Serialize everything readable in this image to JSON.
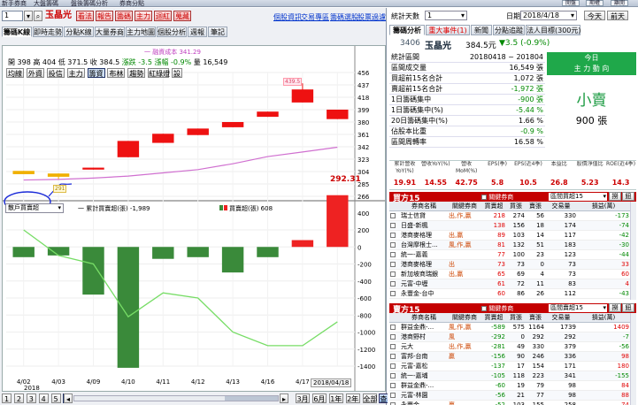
{
  "topbar": {
    "items": [
      "新手券商",
      "大盤籌碼",
      "盤後籌碼分析",
      "券商分點"
    ],
    "right_buttons": [
      "開盤",
      "期權",
      "離開"
    ]
  },
  "toolbar": {
    "code": "1",
    "stock": "玉晶光",
    "buttons": [
      "看法",
      "報告",
      "籌碼",
      "主力",
      "迴紅",
      "蒐藏"
    ],
    "links": [
      "個股資訊",
      "交易專區",
      "籌碼選股",
      "股票過濾"
    ]
  },
  "left_tabs": [
    "籌碼K線",
    "即時走勢",
    "分點K線",
    "大量券商",
    "主力地圖",
    "個股分析",
    "週報",
    "筆記"
  ],
  "chart": {
    "avg_cost_label": "一 融資成本 341.29",
    "ohlc": {
      "開": "398",
      "高": "404",
      "低": "371.5",
      "收": "384.5",
      "漲跌": "-3.5",
      "漲幅": "-0.9%",
      "量": "16,549"
    },
    "sub_tabs": [
      "均線",
      "外資",
      "投信",
      "主力",
      "籌資",
      "布林",
      "趨勢",
      "紅綠燈",
      "設"
    ],
    "active_sub_tab": "籌資",
    "price_label": "292.31",
    "high_label": "439.5",
    "low_label": "291",
    "lower_select": "散戶買賣超",
    "lower_legend_net": "一 累計買賣超(張) -1,989",
    "lower_legend_bar": "買賣超(張) 608",
    "date_box": "2018/04/18",
    "period_buttons": [
      "1",
      "2",
      "3",
      "4",
      "5",
      "6"
    ],
    "range_buttons": [
      "3月",
      "6月",
      "1年",
      "2年",
      "全部",
      "查看"
    ]
  },
  "chart_data": {
    "type": "candlestick",
    "x": [
      "4/02",
      "4/03",
      "4/09",
      "4/10",
      "4/11",
      "4/12",
      "4/13",
      "4/16",
      "4/17",
      "4/18"
    ],
    "year": "2018",
    "price_ticks": [
      456,
      437,
      418,
      399,
      380,
      361,
      342,
      323,
      304,
      285,
      266
    ],
    "open": [
      300,
      301,
      310,
      326,
      348,
      360,
      372,
      388,
      430,
      399
    ],
    "close": [
      305,
      296,
      307,
      351,
      362,
      370,
      380,
      396,
      410,
      384.5
    ],
    "high": [
      305,
      301,
      310,
      351,
      362,
      370,
      380,
      396,
      439.5,
      399
    ],
    "low": [
      300,
      291,
      307,
      326,
      348,
      360,
      372,
      388,
      410,
      384.5
    ],
    "avg_cost": [
      291,
      292,
      294,
      297,
      302,
      307,
      316,
      327,
      334,
      341.29
    ],
    "lower_ticks": [
      200,
      0,
      -200,
      -400,
      -600,
      -800,
      -1000,
      -1200,
      -1400
    ],
    "lower_top_label": "400",
    "net_values": [
      -120,
      -100,
      -560,
      -1420,
      -140,
      -120,
      -300,
      -120,
      80,
      608
    ],
    "cumulative": [
      200,
      -100,
      -200,
      -820,
      -540,
      -600,
      -1000,
      -1160,
      -1160,
      -880
    ]
  },
  "right": {
    "stat_type": "統計天數",
    "days": "1",
    "date_label": "日期:",
    "date": "2018/4/18",
    "today_btn": "今天",
    "prev_btn": "前天",
    "tabs": [
      "籌碼分析",
      "重大事件(1)",
      "新聞",
      "分點追蹤",
      "法人目標(300元)"
    ],
    "code": "3406",
    "name": "玉晶光",
    "price": "384.5元",
    "change": "▼3.5 (-0.9%)",
    "stats": [
      {
        "k": "統計區間",
        "v": "20180418 ~ 201804"
      },
      {
        "k": "區間成交量",
        "v": "16,549 張"
      },
      {
        "k": "買超前15名合計",
        "v": "1,072 張"
      },
      {
        "k": "賣超前15名合計",
        "v": "-1,972 張"
      },
      {
        "k": "1日籌碼集中",
        "v": "-900 張"
      },
      {
        "k": "1日籌碼集中(%)",
        "v": "-5.44 %"
      },
      {
        "k": "20日籌碼集中(%)",
        "v": "1.66 %"
      },
      {
        "k": "佔股本比重",
        "v": "-0.9 %"
      },
      {
        "k": "區間周轉率",
        "v": "16.58 %"
      }
    ],
    "today_title": "今日",
    "today_sub": "主 力 動 向",
    "today_action": "小賣",
    "today_amount": "900 張",
    "fund_headers": [
      "累計營收YoY(%)",
      "營收YoY(%)",
      "營收MoM(%)",
      "EPS(季)",
      "EPS(近4季)",
      "本益比",
      "股價淨值比",
      "ROE(近4季)"
    ],
    "fund_values": [
      "19.91",
      "14.55",
      "42.75",
      "5.8",
      "10.5",
      "26.8",
      "5.23",
      "14.3"
    ],
    "buy_title": "買方15",
    "buy_filter": "關鍵券商",
    "buy_select": "區間買超15",
    "buy_btns": [
      "撈",
      "鈕"
    ],
    "cols": [
      "券商名稱",
      "關鍵券商",
      "買賣超",
      "買張",
      "賣張",
      "交易量",
      "損益(萬)"
    ],
    "buy_rows": [
      [
        "瑞士信貸",
        "出,作,贏",
        "218",
        "274",
        "56",
        "330",
        "-173"
      ],
      [
        "日盛-新楓",
        "",
        "138",
        "156",
        "18",
        "174",
        "-74"
      ],
      [
        "港商麥格理",
        "出,贏",
        "89",
        "103",
        "14",
        "117",
        "-42"
      ],
      [
        "台灣摩根士...",
        "風,作,贏",
        "81",
        "132",
        "51",
        "183",
        "-30"
      ],
      [
        "統一-嘉義",
        "",
        "77",
        "100",
        "23",
        "123",
        "-44"
      ],
      [
        "港商麥格理",
        "出",
        "73",
        "73",
        "0",
        "73",
        "33"
      ],
      [
        "新加坡商瑞銀",
        "出,贏",
        "65",
        "69",
        "4",
        "73",
        "60"
      ],
      [
        "元富-中壢",
        "",
        "61",
        "72",
        "11",
        "83",
        "4"
      ],
      [
        "永豐金-台中",
        "",
        "60",
        "86",
        "26",
        "112",
        "-43"
      ]
    ],
    "sell_title": "賣方15",
    "sell_filter": "關鍵券商",
    "sell_select": "區間賣超15",
    "sell_btns": [
      "撈",
      "鈕"
    ],
    "sell_rows": [
      [
        "群益金鼎-...",
        "風,作,贏",
        "-589",
        "575",
        "1164",
        "1739",
        "1409"
      ],
      [
        "港商野村",
        "風",
        "-292",
        "0",
        "292",
        "292",
        "-7"
      ],
      [
        "元大",
        "出,作,贏",
        "-281",
        "49",
        "330",
        "379",
        "-56"
      ],
      [
        "富邦-台南",
        "贏",
        "-156",
        "90",
        "246",
        "336",
        "98"
      ],
      [
        "元富-嘉松",
        "",
        "-137",
        "17",
        "154",
        "171",
        "180"
      ],
      [
        "統一-嘉埔",
        "",
        "-105",
        "118",
        "223",
        "341",
        "-155"
      ],
      [
        "群益金鼎-...",
        "",
        "-60",
        "19",
        "79",
        "98",
        "84"
      ],
      [
        "元富-林園",
        "",
        "-56",
        "21",
        "77",
        "98",
        "88"
      ],
      [
        "永豐金",
        "贏",
        "-52",
        "103",
        "155",
        "258",
        "74"
      ]
    ]
  }
}
